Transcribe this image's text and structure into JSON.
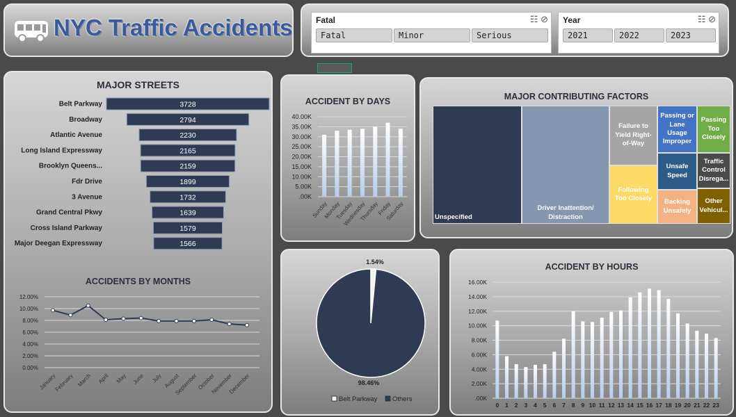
{
  "header": {
    "title": "NYC Traffic Accidents",
    "icon": "bus-icon"
  },
  "slicers": [
    {
      "title": "Fatal",
      "items": [
        "Fatal",
        "Minor",
        "Serious"
      ]
    },
    {
      "title": "Year",
      "items": [
        "2021",
        "2022",
        "2023"
      ]
    }
  ],
  "streets": {
    "title": "MAJOR STREETS",
    "chart_data": {
      "type": "bar",
      "categories": [
        "Belt Parkway",
        "Broadway",
        "Atlantic Avenue",
        "Long Island Expressway",
        "Brooklyn Queens...",
        "Fdr Drive",
        "3 Avenue",
        "Grand Central Pkwy",
        "Cross Island Parkway",
        "Major Deegan Expressway"
      ],
      "values": [
        3728,
        2794,
        2230,
        2165,
        2159,
        1899,
        1732,
        1639,
        1579,
        1566
      ],
      "labels": [
        "3728",
        "2794",
        "2230",
        "2165",
        "2159",
        "1899",
        "1732",
        "1639",
        "1579",
        "1566"
      ],
      "orientation": "horizontal-funnel",
      "color": "#2f3b52"
    }
  },
  "months": {
    "title": "ACCIDENTS BY MONTHS",
    "chart_data": {
      "type": "line",
      "categories": [
        "January",
        "February",
        "March",
        "April",
        "May",
        "June",
        "July",
        "August",
        "September",
        "October",
        "November",
        "December"
      ],
      "values": [
        9.7,
        8.9,
        10.5,
        8.1,
        8.3,
        8.4,
        7.9,
        7.9,
        7.9,
        8.1,
        7.4,
        7.2
      ],
      "ylim": [
        0,
        12
      ],
      "yticks": [
        "0.00%",
        "2.00%",
        "4.00%",
        "6.00%",
        "8.00%",
        "10.00%",
        "12.00%"
      ],
      "color": "#2f3b52"
    }
  },
  "days": {
    "title": "ACCIDENT BY DAYS",
    "chart_data": {
      "type": "bar",
      "categories": [
        "Sunday",
        "Monday",
        "Tuesday",
        "Wednesday",
        "Thursday",
        "Friday",
        "Saturday"
      ],
      "values": [
        31000,
        33000,
        33500,
        34000,
        35000,
        37000,
        34000
      ],
      "ylim": [
        0,
        40000
      ],
      "yticks": [
        ".00K",
        "5.00K",
        "10.00K",
        "15.00K",
        "20.00K",
        "25.00K",
        "30.00K",
        "35.00K",
        "40.00K"
      ]
    }
  },
  "factors": {
    "title": "MAJOR CONTRIBUTING FACTORS",
    "chart_data": {
      "type": "treemap",
      "categories": [
        "Unspecified",
        "Driver Inattention/ Distraction",
        "Failure to Yield Right-of-Way",
        "Following Too Closely",
        "Passing or Lane Usage Improper",
        "Unsafe Speed",
        "Backing Unsafely",
        "Passing Too Closely",
        "Traffic Control Disrega...",
        "Other Vehicul..."
      ],
      "colors": [
        "#2f3b52",
        "#8496b0",
        "#a5a5a5",
        "#ffd966",
        "#4472c4",
        "#2e5c8a",
        "#f4b183",
        "#70ad47",
        "#4a4a4a",
        "#7f6000"
      ]
    }
  },
  "pie": {
    "chart_data": {
      "type": "pie",
      "categories": [
        "Belt Parkway",
        "Others"
      ],
      "values": [
        1.54,
        98.46
      ],
      "labels": [
        "1.54%",
        "98.46%"
      ],
      "colors": [
        "#f2f2f2",
        "#2f3b52"
      ]
    }
  },
  "hours": {
    "title": "ACCIDENT BY HOURS",
    "chart_data": {
      "type": "bar",
      "categories": [
        "0",
        "1",
        "2",
        "3",
        "4",
        "5",
        "6",
        "7",
        "8",
        "9",
        "10",
        "11",
        "12",
        "13",
        "14",
        "15",
        "16",
        "17",
        "18",
        "19",
        "20",
        "21",
        "22",
        "23"
      ],
      "values": [
        10700,
        5800,
        4700,
        4300,
        4600,
        4700,
        6400,
        8200,
        12000,
        10600,
        10500,
        11100,
        11900,
        12100,
        13900,
        14600,
        15100,
        14900,
        13700,
        11700,
        10300,
        9300,
        8900,
        8300
      ],
      "ylim": [
        0,
        16000
      ],
      "yticks": [
        ".00K",
        "2.00K",
        "4.00K",
        "6.00K",
        "8.00K",
        "10.00K",
        "12.00K",
        "14.00K",
        "16.00K"
      ]
    }
  }
}
